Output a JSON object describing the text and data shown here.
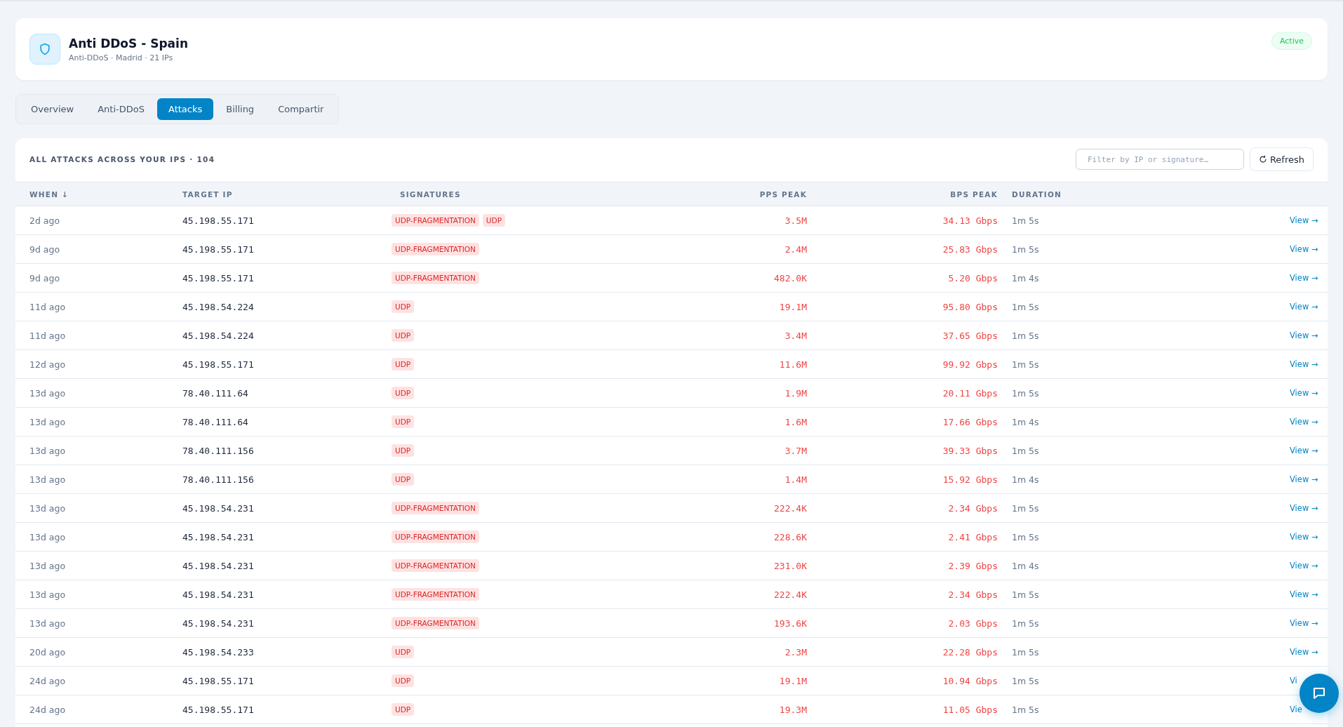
{
  "header": {
    "title": "Anti DDoS - Spain",
    "subtitle": "Anti-DDoS · Madrid · 21 IPs",
    "status": "Active"
  },
  "tabs": [
    {
      "label": "Overview",
      "selected": false
    },
    {
      "label": "Anti-DDoS",
      "selected": false
    },
    {
      "label": "Attacks",
      "selected": true
    },
    {
      "label": "Billing",
      "selected": false
    },
    {
      "label": "Compartir",
      "selected": false
    }
  ],
  "attacks": {
    "title": "ALL ATTACKS ACROSS YOUR IPS · 104",
    "filter": {
      "placeholder": "Filter by IP or signature…"
    },
    "refresh_button": "Refresh",
    "columns": [
      "WHEN ↓",
      "TARGET IP",
      "SIGNATURES",
      "PPS PEAK",
      "BPS PEAK",
      "DURATION"
    ],
    "rows": [
      {
        "when": "2d ago",
        "ip": "45.198.55.171",
        "signatures": [
          "UDP-FRAGMENTATION",
          "UDP"
        ],
        "pps": "3.5M",
        "bps": "34.13 Gbps",
        "duration": "1m 5s",
        "action": "View →"
      },
      {
        "when": "9d ago",
        "ip": "45.198.55.171",
        "signatures": [
          "UDP-FRAGMENTATION"
        ],
        "pps": "2.4M",
        "bps": "25.83 Gbps",
        "duration": "1m 5s",
        "action": "View →"
      },
      {
        "when": "9d ago",
        "ip": "45.198.55.171",
        "signatures": [
          "UDP-FRAGMENTATION"
        ],
        "pps": "482.0K",
        "bps": "5.20 Gbps",
        "duration": "1m 4s",
        "action": "View →"
      },
      {
        "when": "11d ago",
        "ip": "45.198.54.224",
        "signatures": [
          "UDP"
        ],
        "pps": "19.1M",
        "bps": "95.80 Gbps",
        "duration": "1m 5s",
        "action": "View →"
      },
      {
        "when": "11d ago",
        "ip": "45.198.54.224",
        "signatures": [
          "UDP"
        ],
        "pps": "3.4M",
        "bps": "37.65 Gbps",
        "duration": "1m 5s",
        "action": "View →"
      },
      {
        "when": "12d ago",
        "ip": "45.198.55.171",
        "signatures": [
          "UDP"
        ],
        "pps": "11.6M",
        "bps": "99.92 Gbps",
        "duration": "1m 5s",
        "action": "View →"
      },
      {
        "when": "13d ago",
        "ip": "78.40.111.64",
        "signatures": [
          "UDP"
        ],
        "pps": "1.9M",
        "bps": "20.11 Gbps",
        "duration": "1m 5s",
        "action": "View →"
      },
      {
        "when": "13d ago",
        "ip": "78.40.111.64",
        "signatures": [
          "UDP"
        ],
        "pps": "1.6M",
        "bps": "17.66 Gbps",
        "duration": "1m 4s",
        "action": "View →"
      },
      {
        "when": "13d ago",
        "ip": "78.40.111.156",
        "signatures": [
          "UDP"
        ],
        "pps": "3.7M",
        "bps": "39.33 Gbps",
        "duration": "1m 5s",
        "action": "View →"
      },
      {
        "when": "13d ago",
        "ip": "78.40.111.156",
        "signatures": [
          "UDP"
        ],
        "pps": "1.4M",
        "bps": "15.92 Gbps",
        "duration": "1m 4s",
        "action": "View →"
      },
      {
        "when": "13d ago",
        "ip": "45.198.54.231",
        "signatures": [
          "UDP-FRAGMENTATION"
        ],
        "pps": "222.4K",
        "bps": "2.34 Gbps",
        "duration": "1m 5s",
        "action": "View →"
      },
      {
        "when": "13d ago",
        "ip": "45.198.54.231",
        "signatures": [
          "UDP-FRAGMENTATION"
        ],
        "pps": "228.6K",
        "bps": "2.41 Gbps",
        "duration": "1m 5s",
        "action": "View →"
      },
      {
        "when": "13d ago",
        "ip": "45.198.54.231",
        "signatures": [
          "UDP-FRAGMENTATION"
        ],
        "pps": "231.0K",
        "bps": "2.39 Gbps",
        "duration": "1m 4s",
        "action": "View →"
      },
      {
        "when": "13d ago",
        "ip": "45.198.54.231",
        "signatures": [
          "UDP-FRAGMENTATION"
        ],
        "pps": "222.4K",
        "bps": "2.34 Gbps",
        "duration": "1m 5s",
        "action": "View →"
      },
      {
        "when": "13d ago",
        "ip": "45.198.54.231",
        "signatures": [
          "UDP-FRAGMENTATION"
        ],
        "pps": "193.6K",
        "bps": "2.03 Gbps",
        "duration": "1m 5s",
        "action": "View →"
      },
      {
        "when": "20d ago",
        "ip": "45.198.54.233",
        "signatures": [
          "UDP"
        ],
        "pps": "2.3M",
        "bps": "22.28 Gbps",
        "duration": "1m 5s",
        "action": "View →"
      },
      {
        "when": "24d ago",
        "ip": "45.198.55.171",
        "signatures": [
          "UDP"
        ],
        "pps": "19.1M",
        "bps": "10.94 Gbps",
        "duration": "1m 5s",
        "action": "Vi"
      },
      {
        "when": "24d ago",
        "ip": "45.198.55.171",
        "signatures": [
          "UDP"
        ],
        "pps": "19.3M",
        "bps": "11.05 Gbps",
        "duration": "1m 5s",
        "action": "Vie"
      }
    ]
  }
}
